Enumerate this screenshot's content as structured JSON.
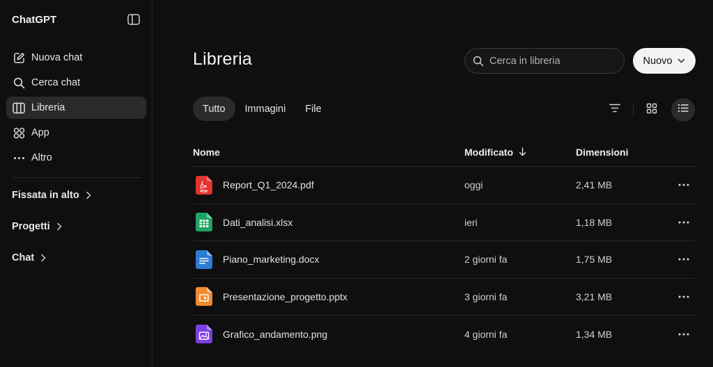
{
  "sidebar": {
    "brand": "ChatGPT",
    "items": [
      {
        "label": "Nuova chat",
        "icon": "edit-icon"
      },
      {
        "label": "Cerca chat",
        "icon": "search-icon"
      },
      {
        "label": "Libreria",
        "icon": "library-icon",
        "active": true
      },
      {
        "label": "App",
        "icon": "apps-grid-icon"
      },
      {
        "label": "Altro",
        "icon": "more-horizontal-icon"
      }
    ],
    "sections": [
      {
        "label": "Fissata in alto"
      },
      {
        "label": "Progetti"
      },
      {
        "label": "Chat"
      }
    ]
  },
  "main": {
    "title": "Libreria",
    "search": {
      "placeholder": "Cerca in libreria"
    },
    "new_button": "Nuovo",
    "tabs": [
      {
        "label": "Tutto",
        "active": true
      },
      {
        "label": "Immagini",
        "active": false
      },
      {
        "label": "File",
        "active": false
      }
    ],
    "view": "list",
    "table": {
      "headers": {
        "name": "Nome",
        "modified": "Modificato",
        "size": "Dimensioni"
      },
      "sort": {
        "column": "modified",
        "direction": "desc"
      },
      "rows": [
        {
          "name": "Report_Q1_2024.pdf",
          "modified": "oggi",
          "size": "2,41 MB",
          "type": "pdf"
        },
        {
          "name": "Dati_analisi.xlsx",
          "modified": "ieri",
          "size": "1,18 MB",
          "type": "xlsx"
        },
        {
          "name": "Piano_marketing.docx",
          "modified": "2 giorni fa",
          "size": "1,75 MB",
          "type": "docx"
        },
        {
          "name": "Presentazione_progetto.pptx",
          "modified": "3 giorni fa",
          "size": "3,21 MB",
          "type": "pptx"
        },
        {
          "name": "Grafico_andamento.png",
          "modified": "4 giorni fa",
          "size": "1,34 MB",
          "type": "png"
        }
      ]
    }
  },
  "colors": {
    "background": "#0f0f0f",
    "active_bg": "#2a2a2a",
    "pdf": "#e5322d",
    "xlsx": "#21a366",
    "docx": "#2b7cd3",
    "pptx": "#f28b30",
    "png": "#7b3fe4"
  }
}
